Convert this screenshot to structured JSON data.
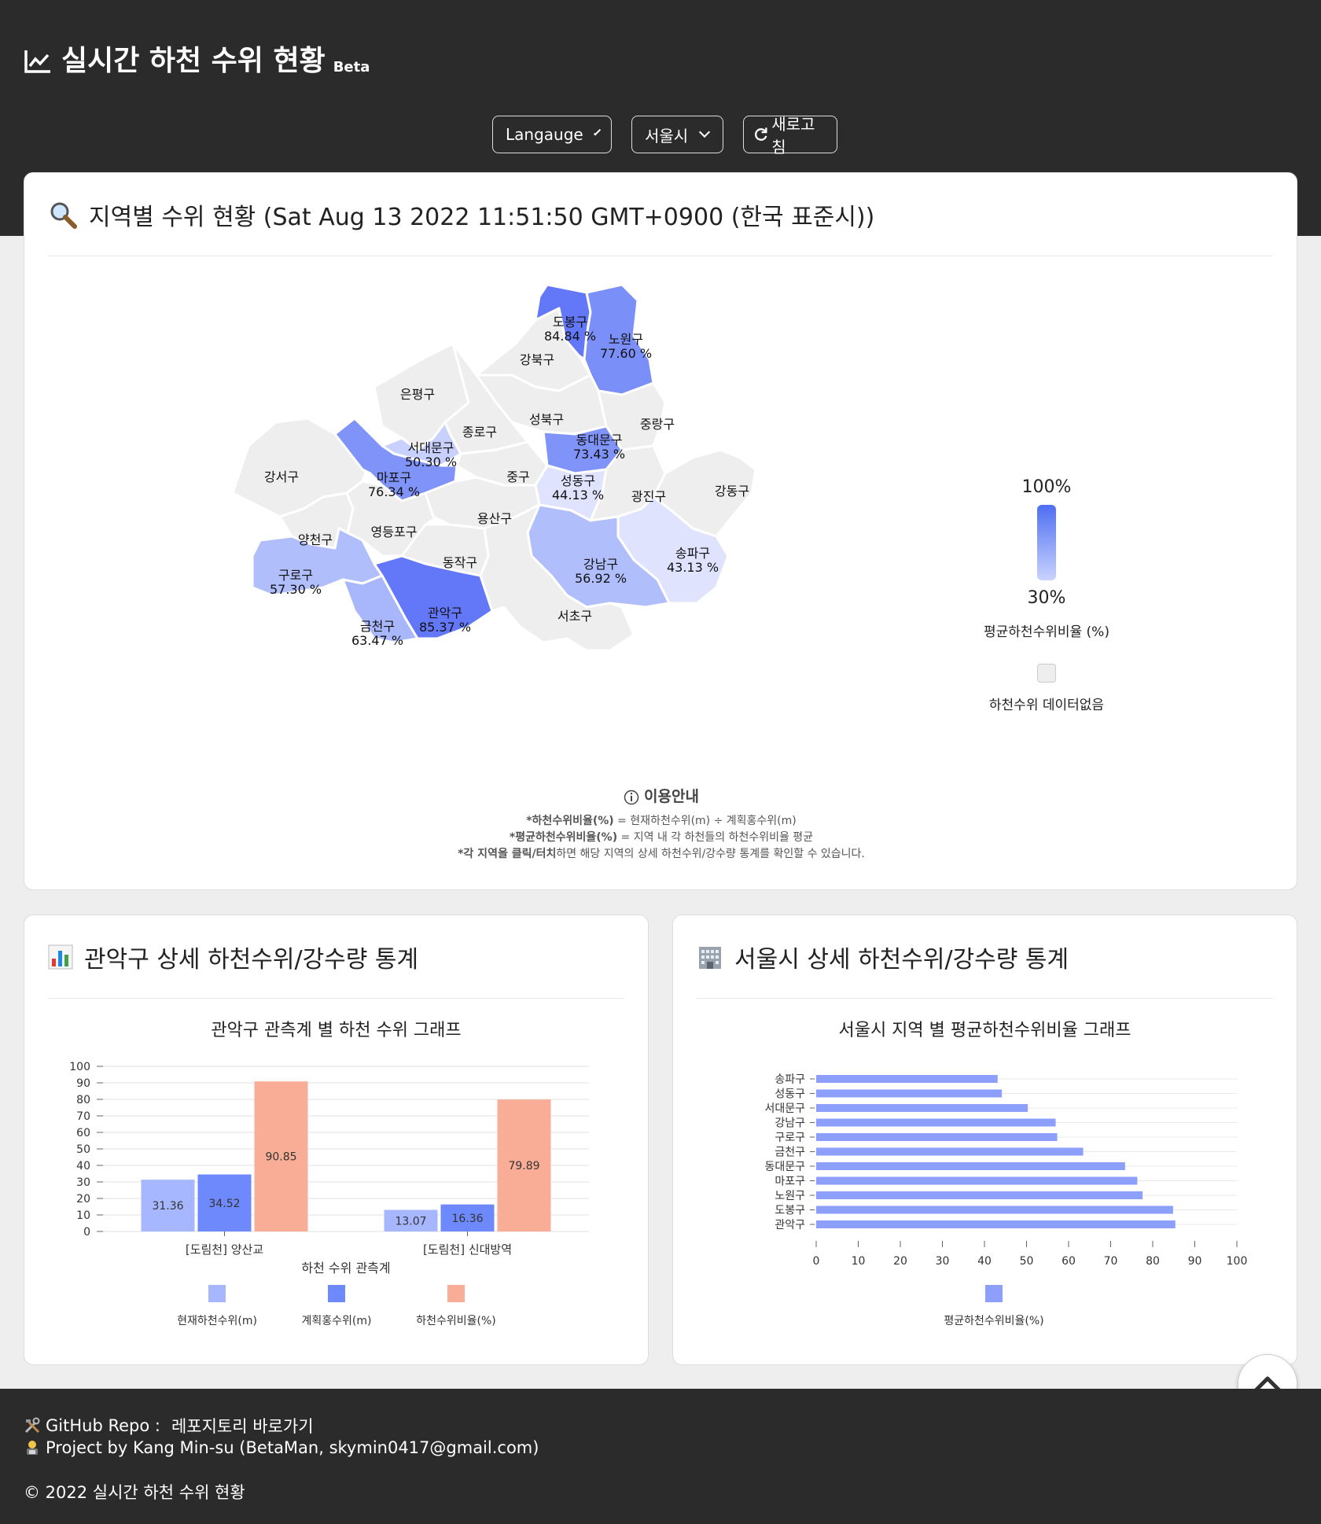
{
  "header": {
    "title": "실시간 하천 수위 현황",
    "beta": "Beta",
    "language_label": "Langauge",
    "city_label": "서울시",
    "refresh_label": "새로고침"
  },
  "map_card": {
    "title": "지역별 수위 현황 (Sat Aug 13 2022 11:51:50 GMT+0900 (한국 표준시))",
    "legend_high": "100%",
    "legend_low": "30%",
    "legend_label": "평균하천수위비율 (%)",
    "legend_nodata": "하천수위 데이터없음",
    "districts": [
      {
        "name": "도봉구",
        "value": "84.84 %"
      },
      {
        "name": "노원구",
        "value": "77.60 %"
      },
      {
        "name": "강북구",
        "value": ""
      },
      {
        "name": "은평구",
        "value": ""
      },
      {
        "name": "성북구",
        "value": ""
      },
      {
        "name": "중랑구",
        "value": ""
      },
      {
        "name": "종로구",
        "value": ""
      },
      {
        "name": "서대문구",
        "value": "50.30 %"
      },
      {
        "name": "동대문구",
        "value": "73.43 %"
      },
      {
        "name": "강서구",
        "value": ""
      },
      {
        "name": "마포구",
        "value": "76.34 %"
      },
      {
        "name": "중구",
        "value": ""
      },
      {
        "name": "성동구",
        "value": "44.13 %"
      },
      {
        "name": "광진구",
        "value": ""
      },
      {
        "name": "강동구",
        "value": ""
      },
      {
        "name": "양천구",
        "value": ""
      },
      {
        "name": "영등포구",
        "value": ""
      },
      {
        "name": "용산구",
        "value": ""
      },
      {
        "name": "송파구",
        "value": "43.13 %"
      },
      {
        "name": "구로구",
        "value": "57.30 %"
      },
      {
        "name": "동작구",
        "value": ""
      },
      {
        "name": "강남구",
        "value": "56.92 %"
      },
      {
        "name": "관악구",
        "value": "85.37 %"
      },
      {
        "name": "서초구",
        "value": ""
      },
      {
        "name": "금천구",
        "value": "63.47 %"
      }
    ],
    "guide_title": "이용안내",
    "guide_lines": [
      {
        "bold": "*하천수위비율(%)",
        "rest": " = 현재하천수위(m) ÷ 계획홍수위(m)"
      },
      {
        "bold": "*평균하천수위비율(%)",
        "rest": " = 지역 내 각 하천들의 하천수위비율 평균"
      },
      {
        "bold": "*각 지역을 클릭/터치",
        "rest": "하면 해당 지역의 상세 하천수위/강수량 통계를 확인할 수 있습니다."
      }
    ]
  },
  "left_card": {
    "title": "관악구 상세 하천수위/강수량 통계"
  },
  "right_card": {
    "title": "서울시 상세 하천수위/강수량 통계"
  },
  "chart_data": [
    {
      "type": "bar",
      "title": "관악구 관측계 별 하천 수위 그래프",
      "xlabel": "하천 수위 관측계",
      "ylabel": "",
      "categories": [
        "[도림천] 양산교",
        "[도림천] 신대방역"
      ],
      "ylim": [
        0,
        100
      ],
      "yticks": [
        0,
        10,
        20,
        30,
        40,
        50,
        60,
        70,
        80,
        90,
        100
      ],
      "series": [
        {
          "name": "현재하천수위(m)",
          "values": [
            31.36,
            13.07
          ],
          "color": "#a6b7ff"
        },
        {
          "name": "계획홍수위(m)",
          "values": [
            34.52,
            16.36
          ],
          "color": "#6d89fb"
        },
        {
          "name": "하천수위비율(%)",
          "values": [
            90.85,
            79.89
          ],
          "color": "#f9ad96"
        }
      ],
      "legend": "bottom",
      "grid": true
    },
    {
      "type": "bar",
      "orientation": "horizontal",
      "title": "서울시 지역 별 평균하천수위비율 그래프",
      "categories": [
        "송파구",
        "성동구",
        "서대문구",
        "강남구",
        "구로구",
        "금천구",
        "동대문구",
        "마포구",
        "노원구",
        "도봉구",
        "관악구"
      ],
      "xlim": [
        0,
        100
      ],
      "xticks": [
        0,
        10,
        20,
        30,
        40,
        50,
        60,
        70,
        80,
        90,
        100
      ],
      "series": [
        {
          "name": "평균하천수위비율(%)",
          "values": [
            43.13,
            44.13,
            50.3,
            56.92,
            57.3,
            63.47,
            73.43,
            76.34,
            77.6,
            84.84,
            85.37
          ],
          "color": "#8b9ffb"
        }
      ],
      "legend": "bottom",
      "grid": true
    }
  ],
  "footer": {
    "repo_label": "GitHub Repo :",
    "repo_link": "레포지토리 바로가기",
    "project": "Project by Kang Min-su (BetaMan, skymin0417@gmail.com)",
    "copyright": "© 2022 실시간 하천 수위 현황"
  }
}
